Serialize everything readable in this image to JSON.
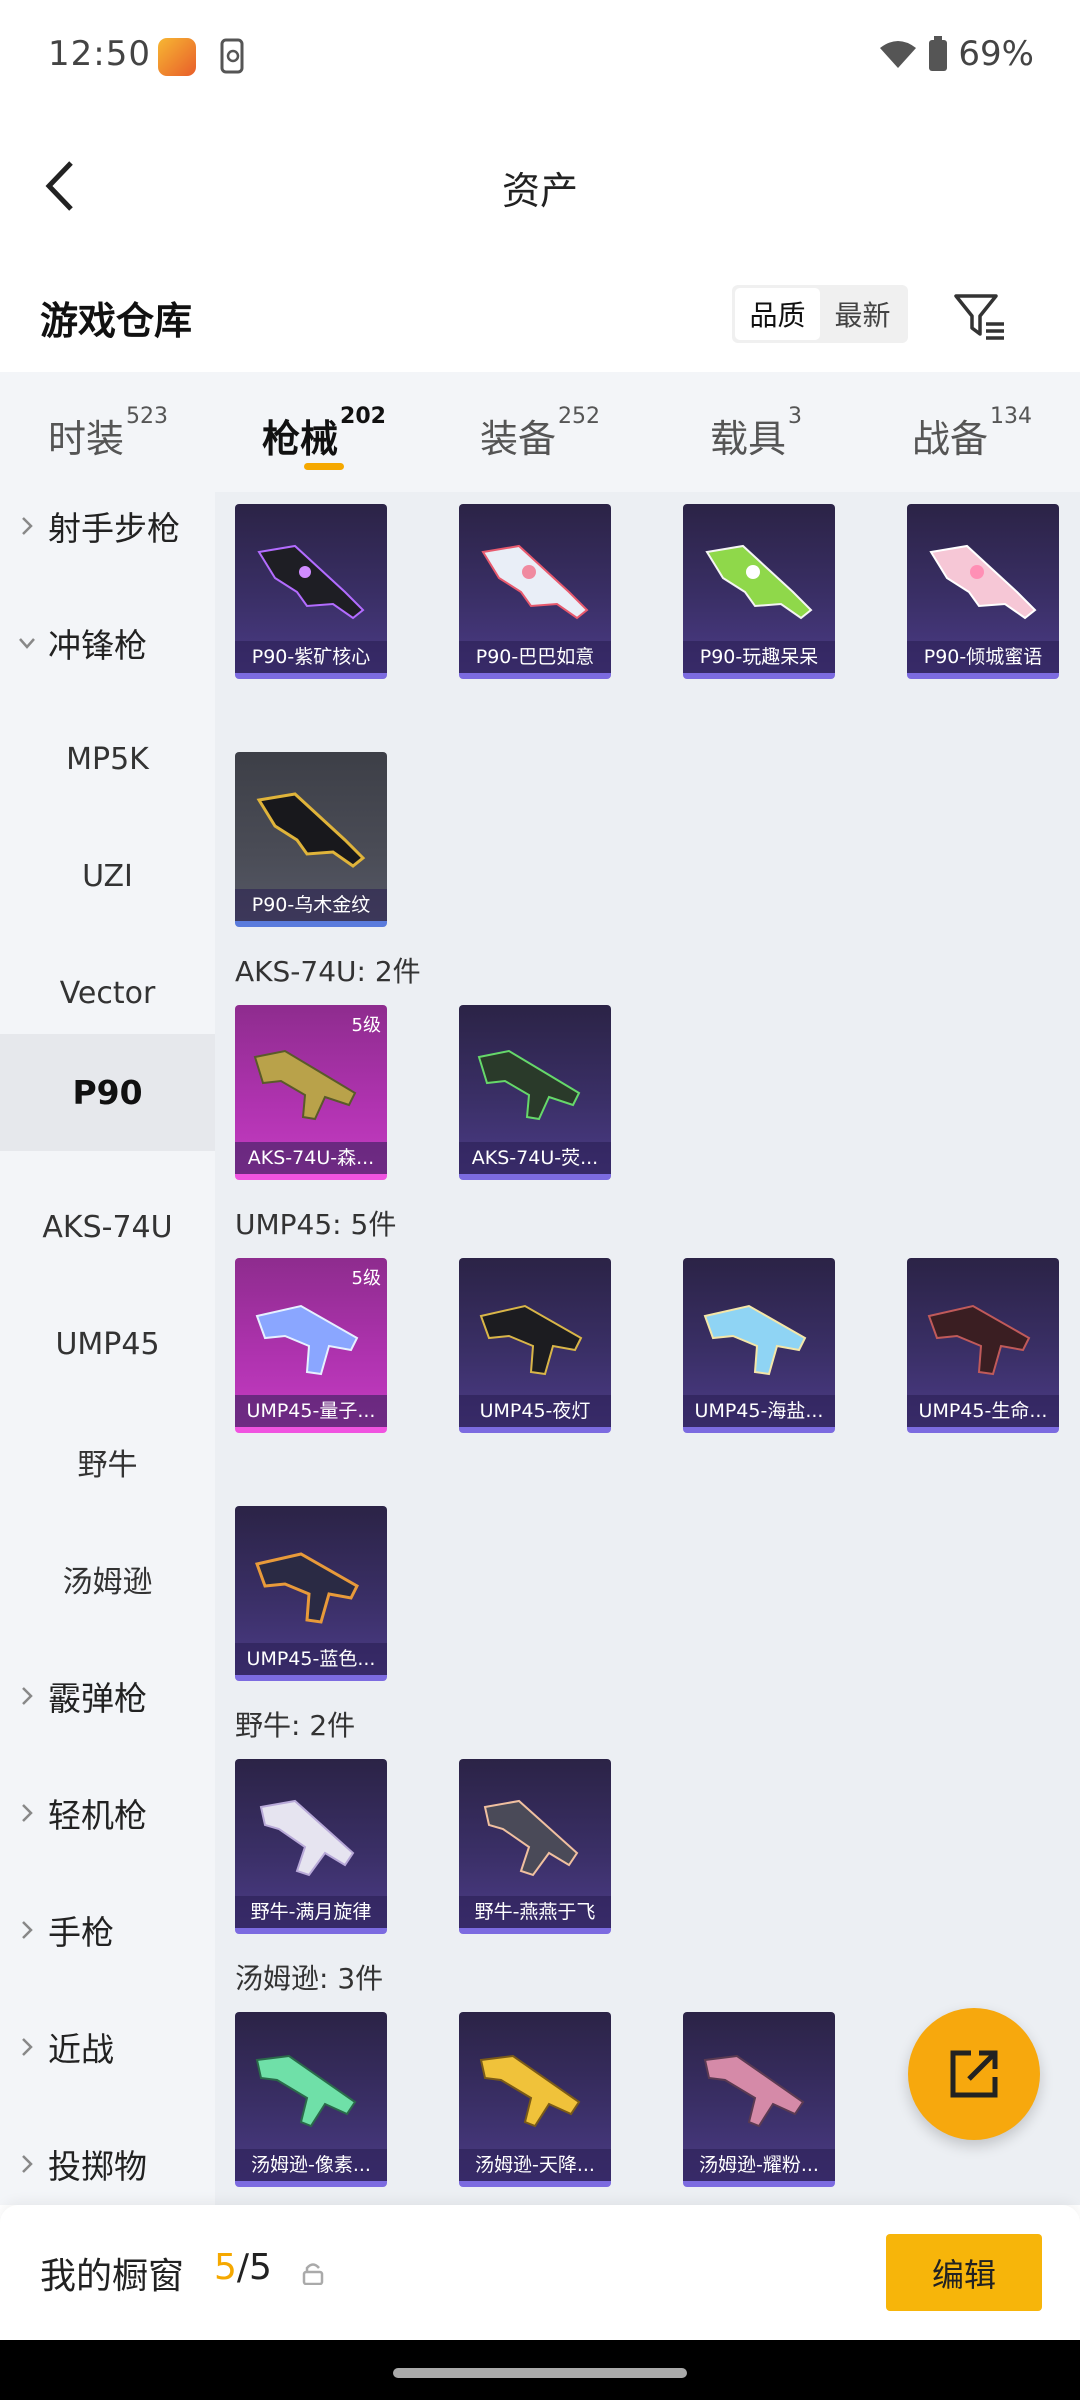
{
  "status_bar": {
    "time": "12:50",
    "battery": "69%"
  },
  "header": {
    "title": "资产"
  },
  "section": {
    "title": "游戏仓库",
    "sort_quality": "品质",
    "sort_latest": "最新"
  },
  "tabs": [
    {
      "label": "时装",
      "count": "523"
    },
    {
      "label": "枪械",
      "count": "202"
    },
    {
      "label": "装备",
      "count": "252"
    },
    {
      "label": "载具",
      "count": "3"
    },
    {
      "label": "战备",
      "count": "134"
    }
  ],
  "sidebar": {
    "items": [
      {
        "label": "射手步枪"
      },
      {
        "label": "冲锋枪"
      },
      {
        "label": "MP5K"
      },
      {
        "label": "UZI"
      },
      {
        "label": "Vector"
      },
      {
        "label": "P90"
      },
      {
        "label": "AKS-74U"
      },
      {
        "label": "UMP45"
      },
      {
        "label": "野牛"
      },
      {
        "label": "汤姆逊"
      },
      {
        "label": "霰弹枪"
      },
      {
        "label": "轻机枪"
      },
      {
        "label": "手枪"
      },
      {
        "label": "近战"
      },
      {
        "label": "投掷物"
      }
    ]
  },
  "groups": {
    "aks": {
      "title": "AKS-74U: 2件"
    },
    "ump": {
      "title": "UMP45: 5件"
    },
    "bizon": {
      "title": "野牛: 2件"
    },
    "thompson": {
      "title": "汤姆逊: 3件"
    }
  },
  "cards": {
    "p90_1": {
      "name": "P90-紫矿核心"
    },
    "p90_2": {
      "name": "P90-巴巴如意"
    },
    "p90_3": {
      "name": "P90-玩趣呆呆"
    },
    "p90_4": {
      "name": "P90-倾城蜜语"
    },
    "p90_5": {
      "name": "P90-乌木金纹"
    },
    "aks_1": {
      "name": "AKS-74U-森...",
      "level": "5级"
    },
    "aks_2": {
      "name": "AKS-74U-荧..."
    },
    "ump_1": {
      "name": "UMP45-量子...",
      "level": "5级"
    },
    "ump_2": {
      "name": "UMP45-夜灯"
    },
    "ump_3": {
      "name": "UMP45-海盐..."
    },
    "ump_4": {
      "name": "UMP45-生命..."
    },
    "ump_5": {
      "name": "UMP45-蓝色..."
    },
    "bizon_1": {
      "name": "野牛-满月旋律"
    },
    "bizon_2": {
      "name": "野牛-燕燕于飞"
    },
    "thompson_1": {
      "name": "汤姆逊-像素..."
    },
    "thompson_2": {
      "name": "汤姆逊-天降..."
    },
    "thompson_3": {
      "name": "汤姆逊-耀粉..."
    }
  },
  "bottom": {
    "showcase_label": "我的橱窗",
    "current": "5",
    "total": "/5",
    "edit_label": "编辑"
  },
  "colors": {
    "accent": "#f7b50a",
    "rare": "#c53cc2",
    "epic": "#4b3b86"
  }
}
